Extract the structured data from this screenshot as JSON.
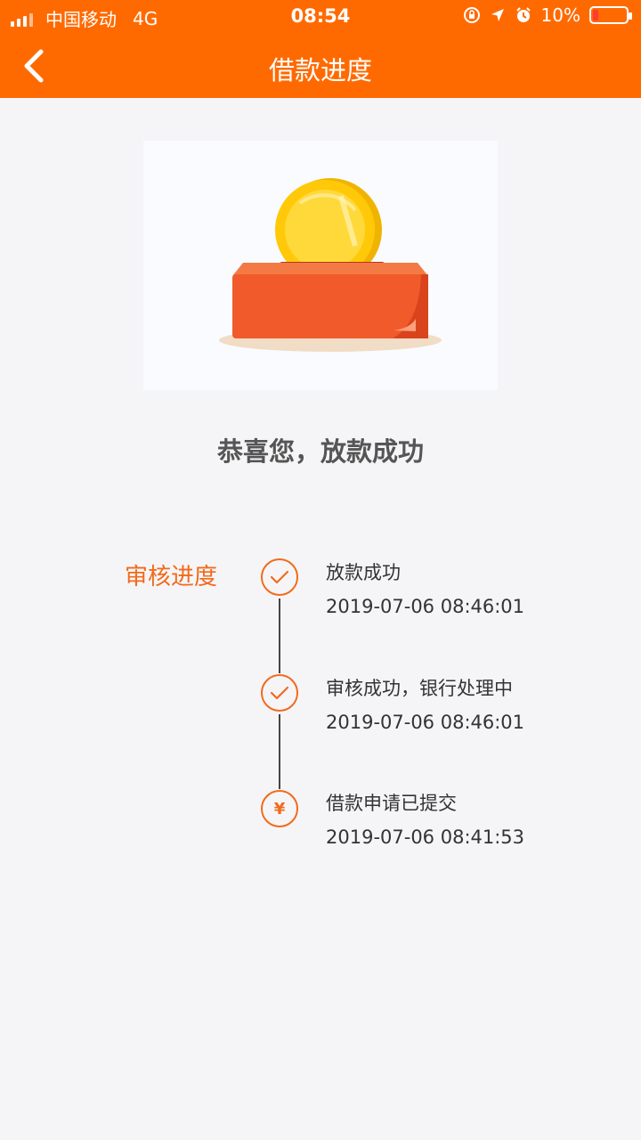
{
  "status_bar": {
    "carrier": "中国移动",
    "network": "4G",
    "time": "08:54",
    "battery": "10%"
  },
  "nav": {
    "title": "借款进度"
  },
  "congrats": "恭喜您，放款成功",
  "progress": {
    "label": "审核进度",
    "steps": [
      {
        "title": "放款成功",
        "datetime": "2019-07-06 08:46:01",
        "icon": "check-icon"
      },
      {
        "title": "审核成功，银行处理中",
        "datetime": "2019-07-06 08:46:01",
        "icon": "check-icon"
      },
      {
        "title": "借款申请已提交",
        "datetime": "2019-07-06 08:41:53",
        "icon": "yen-icon"
      }
    ],
    "yen_symbol": "¥"
  },
  "colors": {
    "brand": "#ff6a00",
    "accent": "#f26a1b",
    "background": "#f5f5f7"
  }
}
